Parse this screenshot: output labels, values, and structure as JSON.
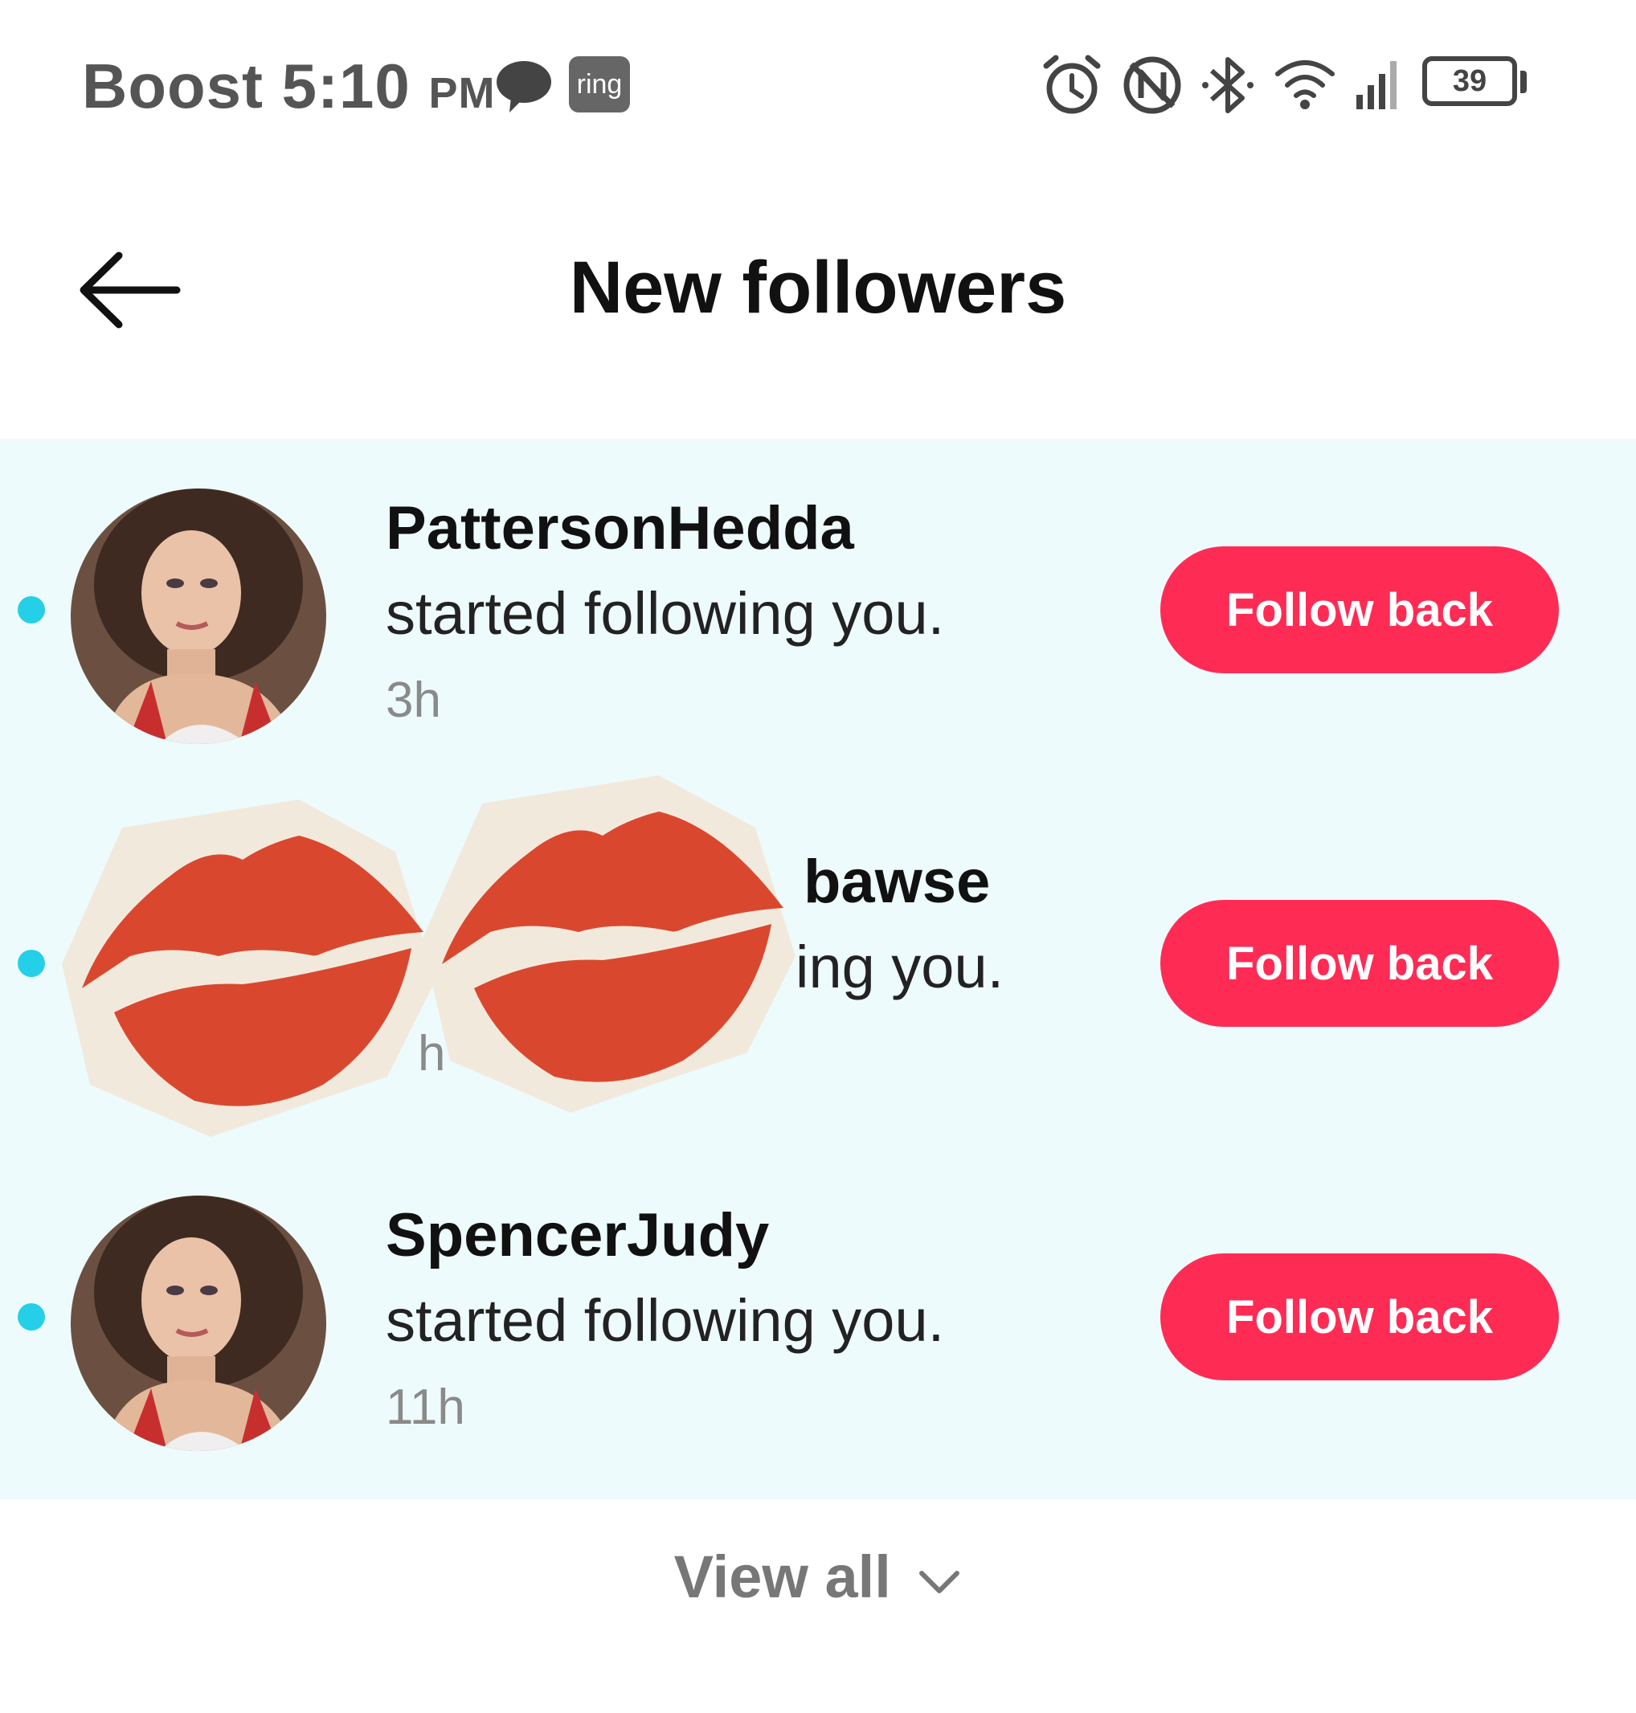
{
  "status_bar": {
    "carrier": "Boost",
    "time": "5:10",
    "ampm": "PM",
    "ring_label": "ring",
    "battery": "39",
    "icons": [
      "message-icon",
      "ring-app-icon",
      "alarm-icon",
      "nfc-icon",
      "bluetooth-icon",
      "wifi-icon",
      "signal-icon",
      "battery-icon"
    ]
  },
  "header": {
    "title": "New followers",
    "back_icon": "arrow-left-icon"
  },
  "followers": [
    {
      "username": "PattersonHedda",
      "action": "started following you.",
      "time": "3h",
      "button": "Follow back",
      "unread": true
    },
    {
      "username": "bawse",
      "action": "ing you.",
      "time": "h",
      "button": "Follow back",
      "unread": true
    },
    {
      "username": "SpencerJudy",
      "action": "started following you.",
      "time": "11h",
      "button": "Follow back",
      "unread": true
    }
  ],
  "footer": {
    "view_all": "View all",
    "icon": "chevron-down-icon"
  },
  "colors": {
    "accent": "#fe2c55",
    "unread_dot": "#25cfe8",
    "list_bg": "#eefbfc",
    "lips": "#d9482e",
    "sticker_bg": "#f2e9dd"
  }
}
